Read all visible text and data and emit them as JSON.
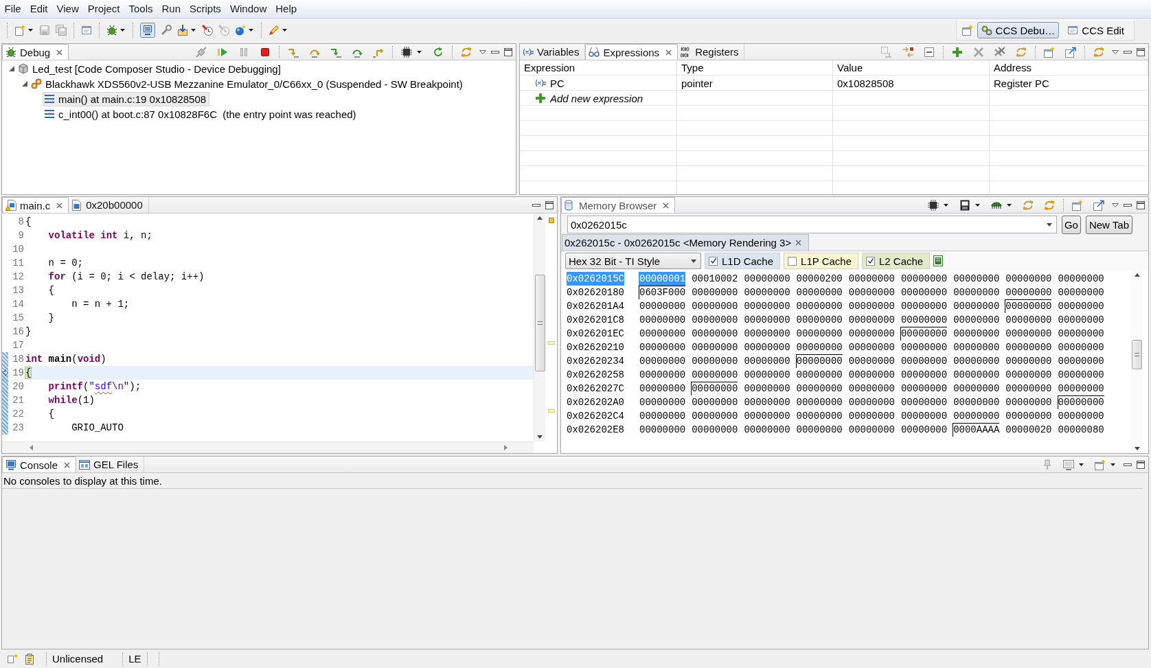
{
  "menu_bar": [
    "File",
    "Edit",
    "View",
    "Project",
    "Tools",
    "Run",
    "Scripts",
    "Window",
    "Help"
  ],
  "perspectives": [
    {
      "label": "CCS Debu…",
      "selected": true
    },
    {
      "label": "CCS Edit",
      "selected": false
    }
  ],
  "debug_view": {
    "tabs": [
      {
        "label": "Debug",
        "selected": true
      }
    ],
    "tree": [
      {
        "kind": "launch",
        "label": "Led_test [Code Composer Studio - Device Debugging]",
        "expanded": true,
        "selected": false,
        "children": [
          {
            "kind": "target",
            "label": "Blackhawk XDS560v2-USB Mezzanine Emulator_0/C66xx_0 (Suspended - SW Breakpoint)",
            "expanded": true,
            "selected": false,
            "children": [
              {
                "kind": "frame",
                "label": "main() at main.c:19 0x10828508",
                "selected": true
              },
              {
                "kind": "frame",
                "label": "c_int00() at boot.c:87 0x10828F6C  (the entry point was reached)",
                "selected": false
              }
            ]
          }
        ]
      }
    ]
  },
  "expressions_view": {
    "tabs": [
      {
        "label": "Variables",
        "selected": false
      },
      {
        "label": "Expressions",
        "selected": true
      },
      {
        "label": "Registers",
        "selected": false
      }
    ],
    "columns": [
      "Expression",
      "Type",
      "Value",
      "Address"
    ],
    "rows": [
      {
        "expression": "PC",
        "type": "pointer",
        "value": "0x10828508",
        "address": "Register PC"
      }
    ],
    "add_expression": "Add new expression"
  },
  "editor": {
    "tabs": [
      {
        "label": "main.c",
        "selected": true
      },
      {
        "label": "0x20b00000",
        "selected": false
      }
    ],
    "lines": [
      {
        "number": "8",
        "current": false,
        "changed": false,
        "tokens": [
          {
            "kind": "plain",
            "text": "{"
          }
        ]
      },
      {
        "number": "9",
        "current": false,
        "changed": false,
        "tokens": [
          {
            "kind": "keyword",
            "text": "    volatile"
          },
          {
            "kind": "keyword",
            "text": " int"
          },
          {
            "kind": "plain",
            "text": " i, n;"
          }
        ]
      },
      {
        "number": "10",
        "current": false,
        "changed": false
      },
      {
        "number": "11",
        "current": false,
        "changed": false,
        "tokens": [
          {
            "kind": "plain",
            "text": "    n = 0;"
          }
        ]
      },
      {
        "number": "12",
        "current": false,
        "changed": false,
        "tokens": [
          {
            "kind": "keyword",
            "text": "    for"
          },
          {
            "kind": "plain",
            "text": " (i = 0; i < delay; i++)"
          }
        ]
      },
      {
        "number": "13",
        "current": false,
        "changed": false,
        "tokens": [
          {
            "kind": "plain",
            "text": "    {"
          }
        ]
      },
      {
        "number": "14",
        "current": false,
        "changed": false,
        "tokens": [
          {
            "kind": "plain",
            "text": "        n = n + 1;"
          }
        ]
      },
      {
        "number": "15",
        "current": false,
        "changed": false,
        "tokens": [
          {
            "kind": "plain",
            "text": "    }"
          }
        ]
      },
      {
        "number": "16",
        "current": false,
        "changed": false,
        "tokens": [
          {
            "kind": "plain",
            "text": "}"
          }
        ]
      },
      {
        "number": "17",
        "current": false,
        "changed": false
      },
      {
        "number": "18",
        "current": false,
        "changed": true,
        "tokens": [
          {
            "kind": "keyword",
            "text": "int"
          },
          {
            "kind": "function",
            "text": " main"
          },
          {
            "kind": "plain",
            "text": "("
          },
          {
            "kind": "keyword",
            "text": "void"
          },
          {
            "kind": "plain",
            "text": ")"
          }
        ]
      },
      {
        "number": "19",
        "current": true,
        "changed": true,
        "tokens": [
          {
            "kind": "matched-bracket",
            "text": "{"
          }
        ]
      },
      {
        "number": "20",
        "current": false,
        "changed": true,
        "tokens": [
          {
            "kind": "call",
            "text": "    printf"
          },
          {
            "kind": "plain",
            "text": "("
          },
          {
            "kind": "string",
            "text": "\""
          },
          {
            "kind": "misspelled",
            "text": "sdf"
          },
          {
            "kind": "string",
            "text": "\\n\""
          },
          {
            "kind": "plain",
            "text": ");"
          }
        ]
      },
      {
        "number": "21",
        "current": false,
        "changed": true,
        "tokens": [
          {
            "kind": "keyword",
            "text": "    while"
          },
          {
            "kind": "plain",
            "text": "(1)"
          }
        ]
      },
      {
        "number": "22",
        "current": false,
        "changed": true,
        "tokens": [
          {
            "kind": "plain",
            "text": "    {"
          }
        ]
      },
      {
        "number": "23",
        "current": false,
        "changed": true,
        "tokens": [
          {
            "kind": "plain",
            "text": "        GRIO_AUTO"
          }
        ]
      }
    ]
  },
  "memory_browser": {
    "tabs": [
      {
        "label": "Memory Browser",
        "selected": true
      }
    ],
    "address": "0x0262015c",
    "go_button": "Go",
    "new_tab_button": "New Tab",
    "rendering_tabs": [
      {
        "label": "0x262015c - 0x0262015c <Memory Rendering 3>",
        "selected": true
      }
    ],
    "format": "Hex 32 Bit - TI Style",
    "caches": [
      {
        "label": "L1D Cache",
        "checked": true,
        "color": "#dbe5f0"
      },
      {
        "label": "L1P Cache",
        "checked": false,
        "color": "#fbf5d2"
      },
      {
        "label": "L2 Cache",
        "checked": true,
        "color": "#e1ebca"
      }
    ],
    "rows": [
      {
        "address": "0x0262015C",
        "selected": true,
        "words": [
          {
            "value": "00000001",
            "selected": true,
            "line_start": false
          },
          {
            "value": "00010002",
            "selected": false,
            "line_start": false
          },
          {
            "value": "00000000",
            "selected": false,
            "line_start": false
          },
          {
            "value": "00000200",
            "selected": false,
            "line_start": false
          },
          {
            "value": "00000000",
            "selected": false,
            "line_start": false
          },
          {
            "value": "00000000",
            "selected": false,
            "line_start": false
          },
          {
            "value": "00000000",
            "selected": false,
            "line_start": false
          },
          {
            "value": "00000000",
            "selected": false,
            "line_start": false
          },
          {
            "value": "00000000",
            "selected": false,
            "line_start": false
          }
        ]
      },
      {
        "address": "0x02620180",
        "selected": false,
        "words": [
          {
            "value": "0603F000",
            "selected": false,
            "line_start": true
          },
          {
            "value": "00000000",
            "selected": false,
            "line_start": false
          },
          {
            "value": "00000000",
            "selected": false,
            "line_start": false
          },
          {
            "value": "00000000",
            "selected": false,
            "line_start": false
          },
          {
            "value": "00000000",
            "selected": false,
            "line_start": false
          },
          {
            "value": "00000000",
            "selected": false,
            "line_start": false
          },
          {
            "value": "00000000",
            "selected": false,
            "line_start": false
          },
          {
            "value": "00000000",
            "selected": false,
            "line_start": false
          },
          {
            "value": "00000000",
            "selected": false,
            "line_start": false
          }
        ]
      },
      {
        "address": "0x026201A4",
        "selected": false,
        "words": [
          {
            "value": "00000000",
            "selected": false,
            "line_start": false
          },
          {
            "value": "00000000",
            "selected": false,
            "line_start": false
          },
          {
            "value": "00000000",
            "selected": false,
            "line_start": false
          },
          {
            "value": "00000000",
            "selected": false,
            "line_start": false
          },
          {
            "value": "00000000",
            "selected": false,
            "line_start": false
          },
          {
            "value": "00000000",
            "selected": false,
            "line_start": false
          },
          {
            "value": "00000000",
            "selected": false,
            "line_start": false
          },
          {
            "value": "00000000",
            "selected": false,
            "line_start": true
          },
          {
            "value": "00000000",
            "selected": false,
            "line_start": false
          }
        ]
      },
      {
        "address": "0x026201C8",
        "selected": false,
        "words": [
          {
            "value": "00000000",
            "selected": false,
            "line_start": false
          },
          {
            "value": "00000000",
            "selected": false,
            "line_start": false
          },
          {
            "value": "00000000",
            "selected": false,
            "line_start": false
          },
          {
            "value": "00000000",
            "selected": false,
            "line_start": false
          },
          {
            "value": "00000000",
            "selected": false,
            "line_start": false
          },
          {
            "value": "00000000",
            "selected": false,
            "line_start": false
          },
          {
            "value": "00000000",
            "selected": false,
            "line_start": false
          },
          {
            "value": "00000000",
            "selected": false,
            "line_start": false
          },
          {
            "value": "00000000",
            "selected": false,
            "line_start": false
          }
        ]
      },
      {
        "address": "0x026201EC",
        "selected": false,
        "words": [
          {
            "value": "00000000",
            "selected": false,
            "line_start": false
          },
          {
            "value": "00000000",
            "selected": false,
            "line_start": false
          },
          {
            "value": "00000000",
            "selected": false,
            "line_start": false
          },
          {
            "value": "00000000",
            "selected": false,
            "line_start": false
          },
          {
            "value": "00000000",
            "selected": false,
            "line_start": false
          },
          {
            "value": "00000000",
            "selected": false,
            "line_start": true
          },
          {
            "value": "00000000",
            "selected": false,
            "line_start": false
          },
          {
            "value": "00000000",
            "selected": false,
            "line_start": false
          },
          {
            "value": "00000000",
            "selected": false,
            "line_start": false
          }
        ]
      },
      {
        "address": "0x02620210",
        "selected": false,
        "words": [
          {
            "value": "00000000",
            "selected": false,
            "line_start": false
          },
          {
            "value": "00000000",
            "selected": false,
            "line_start": false
          },
          {
            "value": "00000000",
            "selected": false,
            "line_start": false
          },
          {
            "value": "00000000",
            "selected": false,
            "line_start": false
          },
          {
            "value": "00000000",
            "selected": false,
            "line_start": false
          },
          {
            "value": "00000000",
            "selected": false,
            "line_start": false
          },
          {
            "value": "00000000",
            "selected": false,
            "line_start": false
          },
          {
            "value": "00000000",
            "selected": false,
            "line_start": false
          },
          {
            "value": "00000000",
            "selected": false,
            "line_start": false
          }
        ]
      },
      {
        "address": "0x02620234",
        "selected": false,
        "words": [
          {
            "value": "00000000",
            "selected": false,
            "line_start": false
          },
          {
            "value": "00000000",
            "selected": false,
            "line_start": false
          },
          {
            "value": "00000000",
            "selected": false,
            "line_start": false
          },
          {
            "value": "00000000",
            "selected": false,
            "line_start": true
          },
          {
            "value": "00000000",
            "selected": false,
            "line_start": false
          },
          {
            "value": "00000000",
            "selected": false,
            "line_start": false
          },
          {
            "value": "00000000",
            "selected": false,
            "line_start": false
          },
          {
            "value": "00000000",
            "selected": false,
            "line_start": false
          },
          {
            "value": "00000000",
            "selected": false,
            "line_start": false
          }
        ]
      },
      {
        "address": "0x02620258",
        "selected": false,
        "words": [
          {
            "value": "00000000",
            "selected": false,
            "line_start": false
          },
          {
            "value": "00000000",
            "selected": false,
            "line_start": false
          },
          {
            "value": "00000000",
            "selected": false,
            "line_start": false
          },
          {
            "value": "00000000",
            "selected": false,
            "line_start": false
          },
          {
            "value": "00000000",
            "selected": false,
            "line_start": false
          },
          {
            "value": "00000000",
            "selected": false,
            "line_start": false
          },
          {
            "value": "00000000",
            "selected": false,
            "line_start": false
          },
          {
            "value": "00000000",
            "selected": false,
            "line_start": false
          },
          {
            "value": "00000000",
            "selected": false,
            "line_start": false
          }
        ]
      },
      {
        "address": "0x0262027C",
        "selected": false,
        "words": [
          {
            "value": "00000000",
            "selected": false,
            "line_start": false
          },
          {
            "value": "00000000",
            "selected": false,
            "line_start": true
          },
          {
            "value": "00000000",
            "selected": false,
            "line_start": false
          },
          {
            "value": "00000000",
            "selected": false,
            "line_start": false
          },
          {
            "value": "00000000",
            "selected": false,
            "line_start": false
          },
          {
            "value": "00000000",
            "selected": false,
            "line_start": false
          },
          {
            "value": "00000000",
            "selected": false,
            "line_start": false
          },
          {
            "value": "00000000",
            "selected": false,
            "line_start": false
          },
          {
            "value": "00000000",
            "selected": false,
            "line_start": false
          }
        ]
      },
      {
        "address": "0x026202A0",
        "selected": false,
        "words": [
          {
            "value": "00000000",
            "selected": false,
            "line_start": false
          },
          {
            "value": "00000000",
            "selected": false,
            "line_start": false
          },
          {
            "value": "00000000",
            "selected": false,
            "line_start": false
          },
          {
            "value": "00000000",
            "selected": false,
            "line_start": false
          },
          {
            "value": "00000000",
            "selected": false,
            "line_start": false
          },
          {
            "value": "00000000",
            "selected": false,
            "line_start": false
          },
          {
            "value": "00000000",
            "selected": false,
            "line_start": false
          },
          {
            "value": "00000000",
            "selected": false,
            "line_start": false
          },
          {
            "value": "00000000",
            "selected": false,
            "line_start": true
          }
        ]
      },
      {
        "address": "0x026202C4",
        "selected": false,
        "words": [
          {
            "value": "00000000",
            "selected": false,
            "line_start": false
          },
          {
            "value": "00000000",
            "selected": false,
            "line_start": false
          },
          {
            "value": "00000000",
            "selected": false,
            "line_start": false
          },
          {
            "value": "00000000",
            "selected": false,
            "line_start": false
          },
          {
            "value": "00000000",
            "selected": false,
            "line_start": false
          },
          {
            "value": "00000000",
            "selected": false,
            "line_start": false
          },
          {
            "value": "00000000",
            "selected": false,
            "line_start": false
          },
          {
            "value": "00000000",
            "selected": false,
            "line_start": false
          },
          {
            "value": "00000000",
            "selected": false,
            "line_start": false
          }
        ]
      },
      {
        "address": "0x026202E8",
        "selected": false,
        "words": [
          {
            "value": "00000000",
            "selected": false,
            "line_start": false
          },
          {
            "value": "00000000",
            "selected": false,
            "line_start": false
          },
          {
            "value": "00000000",
            "selected": false,
            "line_start": false
          },
          {
            "value": "00000000",
            "selected": false,
            "line_start": false
          },
          {
            "value": "00000000",
            "selected": false,
            "line_start": false
          },
          {
            "value": "00000000",
            "selected": false,
            "line_start": false
          },
          {
            "value": "0000AAAA",
            "selected": false,
            "line_start": true
          },
          {
            "value": "00000020",
            "selected": false,
            "line_start": false
          },
          {
            "value": "00000080",
            "selected": false,
            "line_start": false
          }
        ]
      }
    ]
  },
  "console_view": {
    "tabs": [
      {
        "label": "Console",
        "selected": true
      },
      {
        "label": "GEL Files",
        "selected": false
      }
    ],
    "message": "No consoles to display at this time."
  },
  "status_bar": {
    "license": "Unlicensed",
    "endianness": "LE"
  }
}
